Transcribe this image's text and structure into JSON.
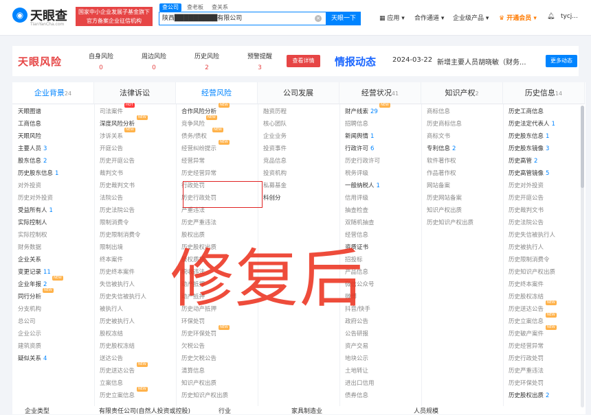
{
  "header": {
    "logo_text": "天眼查",
    "logo_sub": "TianYanCha.com",
    "banner_line1": "国家中小企业发展子基金旗下",
    "banner_line2": "官方备案企业征信机构",
    "search_tabs": [
      "查公司",
      "查老板",
      "查关系"
    ],
    "search_value": "陕西█████████有限公司",
    "search_button": "天眼一下",
    "nav": [
      "应用",
      "合作通道",
      "企业级产品",
      "开通会员",
      "tycj..."
    ]
  },
  "risk": {
    "logo": "天眼风险",
    "stats": [
      {
        "label": "自身风险",
        "value": "0"
      },
      {
        "label": "周边风险",
        "value": "0"
      },
      {
        "label": "历史风险",
        "value": "2"
      },
      {
        "label": "预警提醒",
        "value": "3"
      }
    ],
    "check_button": "查看详情",
    "news_logo": "情报动态",
    "news_date": "2024-03-22",
    "news_text": "新增主要人员胡晓敏（财务...",
    "more_button": "更多动态"
  },
  "columns": [
    {
      "title": "企业背景",
      "count": "24",
      "active": true,
      "items": [
        {
          "label": "天眼图谱",
          "on": true
        },
        {
          "label": "工商信息",
          "on": true
        },
        {
          "label": "天眼风险",
          "on": true
        },
        {
          "label": "主要人员",
          "count": "3",
          "on": true
        },
        {
          "label": "股东信息",
          "count": "2",
          "on": true
        },
        {
          "label": "历史股东信息",
          "count": "1",
          "on": true
        },
        {
          "label": "对外投资",
          "on": false
        },
        {
          "label": "历史对外投资",
          "on": false
        },
        {
          "label": "受益所有人",
          "count": "1",
          "on": true
        },
        {
          "label": "实际控制人",
          "on": true
        },
        {
          "label": "实际控制权",
          "on": false
        },
        {
          "label": "财务数据",
          "on": false
        },
        {
          "label": "企业关系",
          "on": true
        },
        {
          "label": "变更记录",
          "count": "11",
          "on": true
        },
        {
          "label": "企业年报",
          "count": "2",
          "on": true,
          "badge": "NEW"
        },
        {
          "label": "同行分析",
          "on": true,
          "badge": "NEW"
        },
        {
          "label": "分支机构",
          "on": false
        },
        {
          "label": "总公司",
          "on": false
        },
        {
          "label": "企业公示",
          "on": false
        },
        {
          "label": "建筑资质",
          "on": false
        },
        {
          "label": "疑似关系",
          "count": "4",
          "on": true
        }
      ]
    },
    {
      "title": "法律诉讼",
      "count": "",
      "active": false,
      "items": [
        {
          "label": "司法案件",
          "on": false,
          "badge": "HOT"
        },
        {
          "label": "深度风险分析",
          "on": true,
          "badge": "NEW"
        },
        {
          "label": "涉诉关系",
          "on": false,
          "badge": "NEW"
        },
        {
          "label": "开庭公告",
          "on": false
        },
        {
          "label": "历史开庭公告",
          "on": false
        },
        {
          "label": "裁判文书",
          "on": false
        },
        {
          "label": "历史裁判文书",
          "on": false
        },
        {
          "label": "法院公告",
          "on": false
        },
        {
          "label": "历史法院公告",
          "on": false
        },
        {
          "label": "限制消费令",
          "on": false
        },
        {
          "label": "历史限制消费令",
          "on": false
        },
        {
          "label": "限制出境",
          "on": false
        },
        {
          "label": "终本案件",
          "on": false
        },
        {
          "label": "历史终本案件",
          "on": false
        },
        {
          "label": "失信被执行人",
          "on": false
        },
        {
          "label": "历史失信被执行人",
          "on": false
        },
        {
          "label": "被执行人",
          "on": false
        },
        {
          "label": "历史被执行人",
          "on": false
        },
        {
          "label": "股权冻结",
          "on": false
        },
        {
          "label": "历史股权冻结",
          "on": false
        },
        {
          "label": "送达公告",
          "on": false
        },
        {
          "label": "历史送达公告",
          "on": false,
          "badge": "NEW"
        },
        {
          "label": "立案信息",
          "on": false
        },
        {
          "label": "历史立案信息",
          "on": false,
          "badge": "NEW"
        }
      ]
    },
    {
      "title": "经营风险",
      "count": "",
      "active": true,
      "items": [
        {
          "label": "合作风险分析",
          "on": true,
          "badge": "NEW"
        },
        {
          "label": "竞争风险",
          "on": false,
          "badge": "NEW"
        },
        {
          "label": "债务/债权",
          "on": false,
          "badge": "NEW"
        },
        {
          "label": "经营纠纷提示",
          "on": false,
          "badge": "NEW"
        },
        {
          "label": "经营异常",
          "on": false
        },
        {
          "label": "历史经营异常",
          "on": false
        },
        {
          "label": "行政处罚",
          "on": false
        },
        {
          "label": "历史行政处罚",
          "on": false
        },
        {
          "label": "严重违法",
          "on": false
        },
        {
          "label": "历史严重违法",
          "on": false
        },
        {
          "label": "股权出质",
          "on": false
        },
        {
          "label": "历史股权出质",
          "on": false
        },
        {
          "label": "股权质押",
          "on": false
        },
        {
          "label": "税收违法",
          "on": false
        },
        {
          "label": "动产抵押",
          "on": false
        },
        {
          "label": "动产抵押",
          "on": false
        },
        {
          "label": "历史动产抵押",
          "on": false
        },
        {
          "label": "环保处罚",
          "on": false
        },
        {
          "label": "历史环保处罚",
          "on": false,
          "badge": "NEW"
        },
        {
          "label": "欠税公告",
          "on": false
        },
        {
          "label": "历史欠税公告",
          "on": false
        },
        {
          "label": "清算信息",
          "on": false
        },
        {
          "label": "知识产权出质",
          "on": false
        },
        {
          "label": "历史知识产权出质",
          "on": false
        }
      ]
    },
    {
      "title": "公司发展",
      "count": "",
      "active": false,
      "items": [
        {
          "label": "融资历程",
          "on": false
        },
        {
          "label": "核心团队",
          "on": false
        },
        {
          "label": "企业业务",
          "on": false
        },
        {
          "label": "投资事件",
          "on": false
        },
        {
          "label": "竞品信息",
          "on": false
        },
        {
          "label": "投资机构",
          "on": false
        },
        {
          "label": "私募基金",
          "on": false
        },
        {
          "label": "科创分",
          "on": true
        }
      ]
    },
    {
      "title": "经营状况",
      "count": "41",
      "active": false,
      "items": [
        {
          "label": "财产线索",
          "count": "29",
          "on": true,
          "badge": "NEW"
        },
        {
          "label": "招聘信息",
          "on": false
        },
        {
          "label": "新闻舆情",
          "count": "1",
          "on": true
        },
        {
          "label": "行政许可",
          "count": "6",
          "on": true
        },
        {
          "label": "历史行政许可",
          "on": false
        },
        {
          "label": "税务评级",
          "on": false
        },
        {
          "label": "一般纳税人",
          "count": "1",
          "on": true
        },
        {
          "label": "信用评级",
          "on": false
        },
        {
          "label": "抽查检查",
          "on": false
        },
        {
          "label": "双随机抽查",
          "on": false
        },
        {
          "label": "经营信息",
          "on": false
        },
        {
          "label": "资质证书",
          "on": true
        },
        {
          "label": "招投标",
          "on": false
        },
        {
          "label": "产品信息",
          "on": false
        },
        {
          "label": "微信公众号",
          "on": false
        },
        {
          "label": "微博",
          "on": false
        },
        {
          "label": "抖音/快手",
          "on": false
        },
        {
          "label": "政府公告",
          "on": false
        },
        {
          "label": "公告研报",
          "on": false
        },
        {
          "label": "资产交易",
          "on": false
        },
        {
          "label": "地块公示",
          "on": false
        },
        {
          "label": "土地转让",
          "on": false
        },
        {
          "label": "进出口信用",
          "on": false
        },
        {
          "label": "债券信息",
          "on": false
        }
      ]
    },
    {
      "title": "知识产权",
      "count": "2",
      "active": false,
      "items": [
        {
          "label": "商标信息",
          "on": false
        },
        {
          "label": "历史商标信息",
          "on": false
        },
        {
          "label": "商标文书",
          "on": false
        },
        {
          "label": "专利信息",
          "count": "2",
          "on": true
        },
        {
          "label": "软件著作权",
          "on": false
        },
        {
          "label": "作品著作权",
          "on": false
        },
        {
          "label": "网站备案",
          "on": false
        },
        {
          "label": "历史网站备案",
          "on": false
        },
        {
          "label": "知识产权出质",
          "on": false
        },
        {
          "label": "历史知识产权出质",
          "on": false
        }
      ]
    },
    {
      "title": "历史信息",
      "count": "14",
      "active": false,
      "items": [
        {
          "label": "历史工商信息",
          "on": true
        },
        {
          "label": "历史法定代表人",
          "count": "1",
          "on": true
        },
        {
          "label": "历史股东信息",
          "count": "1",
          "on": true
        },
        {
          "label": "历史股东镜像",
          "count": "3",
          "on": true
        },
        {
          "label": "历史高管",
          "count": "2",
          "on": true
        },
        {
          "label": "历史高管镜像",
          "count": "5",
          "on": true
        },
        {
          "label": "历史对外投资",
          "on": false
        },
        {
          "label": "历史开庭公告",
          "on": false
        },
        {
          "label": "历史裁判文书",
          "on": false
        },
        {
          "label": "历史法院公告",
          "on": false
        },
        {
          "label": "历史失信被执行人",
          "on": false
        },
        {
          "label": "历史被执行人",
          "on": false
        },
        {
          "label": "历史限制消费令",
          "on": false
        },
        {
          "label": "历史知识产权出质",
          "on": false
        },
        {
          "label": "历史终本案件",
          "on": false
        },
        {
          "label": "历史股权冻结",
          "on": false
        },
        {
          "label": "历史送达公告",
          "on": false,
          "badge": "NEW"
        },
        {
          "label": "历史立案信息",
          "on": false,
          "badge": "NEW"
        },
        {
          "label": "历史破产案件",
          "on": false,
          "badge": "NEW"
        },
        {
          "label": "历史经营异常",
          "on": false
        },
        {
          "label": "历史行政处罚",
          "on": false
        },
        {
          "label": "历史严重违法",
          "on": false
        },
        {
          "label": "历史环保处罚",
          "on": false
        },
        {
          "label": "历史股权出质",
          "count": "2",
          "on": true
        }
      ]
    }
  ],
  "watermark": "修复后",
  "bottom_row": [
    "企业类型",
    "有限责任公司(自然人投资或控股)",
    "行业",
    "家具制造业",
    "人员规模"
  ]
}
